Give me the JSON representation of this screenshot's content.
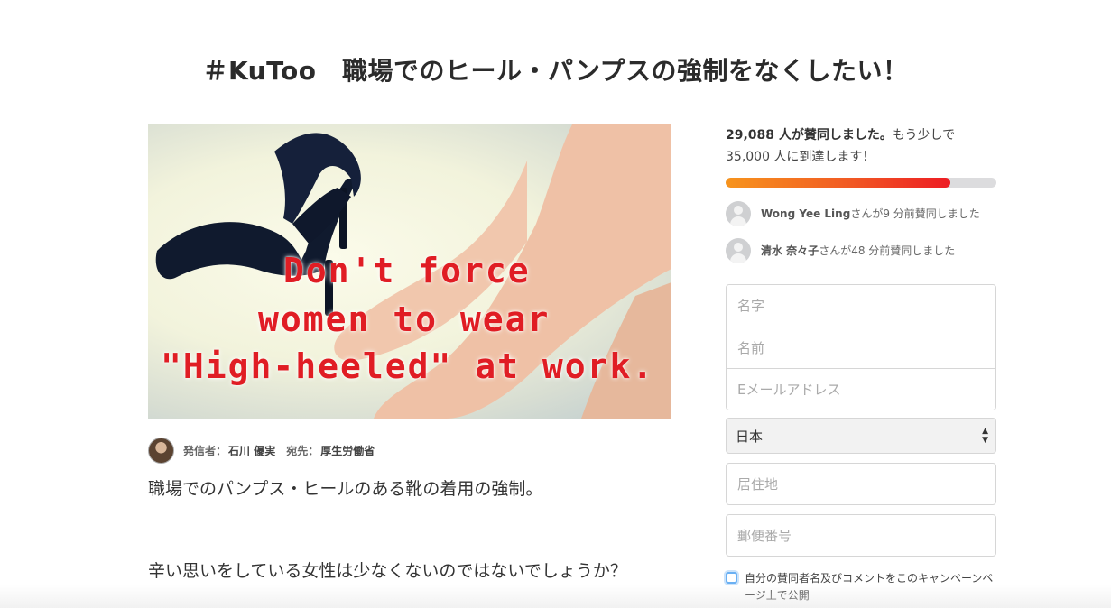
{
  "page": {
    "title": "＃KuToo　職場でのヒール・パンプスの強制をなくしたい！"
  },
  "hero_image": {
    "overlay_text": [
      "Don't force",
      "women to wear",
      "\"High-heeled\" at work."
    ]
  },
  "author": {
    "sender_label": "発信者：",
    "sender_name": "石川 優実",
    "recipient_label": "宛先：",
    "recipient_name": "厚生労働省"
  },
  "body": {
    "paragraphs": [
      "職場でのパンプス・ヒールのある靴の着用の強制。",
      "辛い思いをしている女性は少なくないのではないでしょうか？"
    ]
  },
  "sidebar": {
    "goal_bold": "29,088 人が賛同しました。",
    "goal_rest_1": "もう少しで",
    "goal_rest_2": "35,000 人に到達します！",
    "progress_fraction": 0.831,
    "recent_signers": [
      {
        "name": "Wong Yee Ling",
        "action": "さんが9 分前賛同しました"
      },
      {
        "name": "清水 奈々子",
        "action": "さんが48 分前賛同しました"
      }
    ]
  },
  "form": {
    "last_name_placeholder": "名字",
    "first_name_placeholder": "名前",
    "email_placeholder": "Eメールアドレス",
    "country_value": "日本",
    "city_placeholder": "居住地",
    "postal_placeholder": "郵便番号",
    "public_checkbox_label": "自分の賛同者名及びコメントをこのキャンペーンページ上で公開",
    "public_checkbox_checked": false
  },
  "colors": {
    "progress_start": "#f7941d",
    "progress_end": "#ed1c24",
    "overlay_text": "#e01d24"
  }
}
